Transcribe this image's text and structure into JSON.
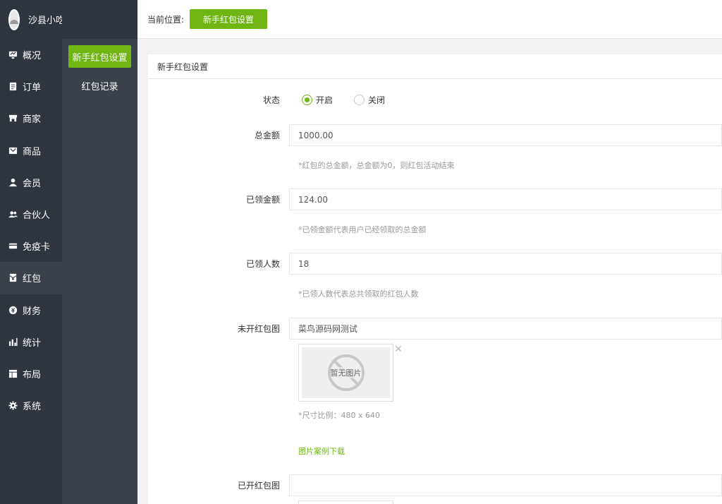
{
  "store_name": "沙县小吃街",
  "nav": {
    "items": [
      {
        "label": "概况",
        "icon": "monitor-icon"
      },
      {
        "label": "订单",
        "icon": "order-icon"
      },
      {
        "label": "商家",
        "icon": "store-icon"
      },
      {
        "label": "商品",
        "icon": "goods-icon"
      },
      {
        "label": "会员",
        "icon": "user-icon"
      },
      {
        "label": "合伙人",
        "icon": "partner-icon"
      },
      {
        "label": "免疫卡",
        "icon": "card-icon"
      },
      {
        "label": "红包",
        "icon": "redpacket-icon"
      },
      {
        "label": "财务",
        "icon": "finance-icon"
      },
      {
        "label": "统计",
        "icon": "stats-icon"
      },
      {
        "label": "布局",
        "icon": "layout-icon"
      },
      {
        "label": "系统",
        "icon": "gear-icon"
      }
    ],
    "active": "红包"
  },
  "subnav": {
    "items": [
      {
        "label": "新手红包设置"
      },
      {
        "label": "红包记录"
      }
    ],
    "active": "新手红包设置"
  },
  "breadcrumb": {
    "label": "当前位置:",
    "current": "新手红包设置"
  },
  "panel": {
    "title": "新手红包设置",
    "status": {
      "label": "状态",
      "options": [
        "开启",
        "关闭"
      ],
      "selected": "开启"
    },
    "total_amount": {
      "label": "总金额",
      "value": "1000.00",
      "hint": "*红包的总金额，总金额为0，则红包活动结束"
    },
    "claimed_amount": {
      "label": "已领金额",
      "value": "124.00",
      "hint": "*已领金额代表用户已经领取的总金额"
    },
    "claimed_people": {
      "label": "已领人数",
      "value": "18",
      "hint": "*已领人数代表总共领取的红包人数"
    },
    "unopened_image": {
      "label": "未开红包图",
      "value": "菜鸟源码网测试",
      "placeholder_text": "暂无图片",
      "remove_symbol": "✕",
      "size_hint": "*尺寸比例：480 x 640",
      "download_link": "图片案例下载"
    },
    "opened_image": {
      "label": "已开红包图",
      "value": ""
    }
  },
  "colors": {
    "accent": "#6fb513",
    "sidebar_bg": "#2f353f",
    "subnav_bg": "#3b414b"
  }
}
